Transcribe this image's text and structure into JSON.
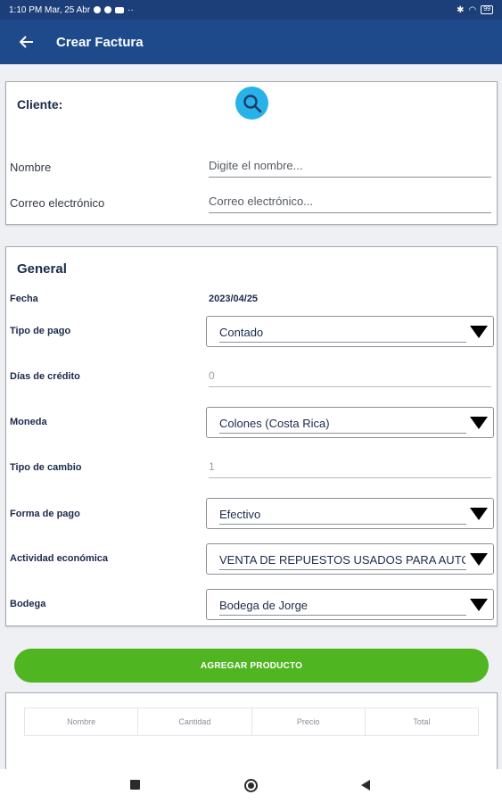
{
  "status_bar": {
    "time_date": "1:10 PM Mar, 25 Abr",
    "extra": "··",
    "battery": "99"
  },
  "app_bar": {
    "title": "Crear Factura",
    "background_color": "#1e4a8c"
  },
  "client_section": {
    "title": "Cliente:",
    "search_icon": "search-icon",
    "fields": [
      {
        "label": "Nombre",
        "placeholder": "Digite el nombre...",
        "value": ""
      },
      {
        "label": "Correo electrónico",
        "placeholder": "Correo electrónico...",
        "value": ""
      }
    ]
  },
  "general_section": {
    "title": "General",
    "fecha": {
      "label": "Fecha",
      "value": "2023/04/25"
    },
    "tipo_pago": {
      "label": "Tipo de pago",
      "selected": "Contado"
    },
    "dias_credito": {
      "label": "Días de crédito",
      "value": "0"
    },
    "moneda": {
      "label": "Moneda",
      "selected": "Colones (Costa Rica)"
    },
    "tipo_cambio": {
      "label": "Tipo de cambio",
      "value": "1"
    },
    "forma_pago": {
      "label": "Forma de pago",
      "selected": "Efectivo"
    },
    "actividad": {
      "label": "Actividad económica",
      "selected": "VENTA DE REPUESTOS USADOS PARA AUTO"
    },
    "bodega": {
      "label": "Bodega",
      "selected": "Bodega de Jorge"
    }
  },
  "add_product": {
    "label": "AGREGAR PRODUCTO",
    "color": "#4fb520"
  },
  "product_table": {
    "columns": [
      "Nombre",
      "Cantidad",
      "Precio",
      "Total"
    ]
  },
  "nav_bar": {
    "icons": [
      "recents-square-icon",
      "home-circle-icon",
      "back-triangle-icon"
    ]
  }
}
